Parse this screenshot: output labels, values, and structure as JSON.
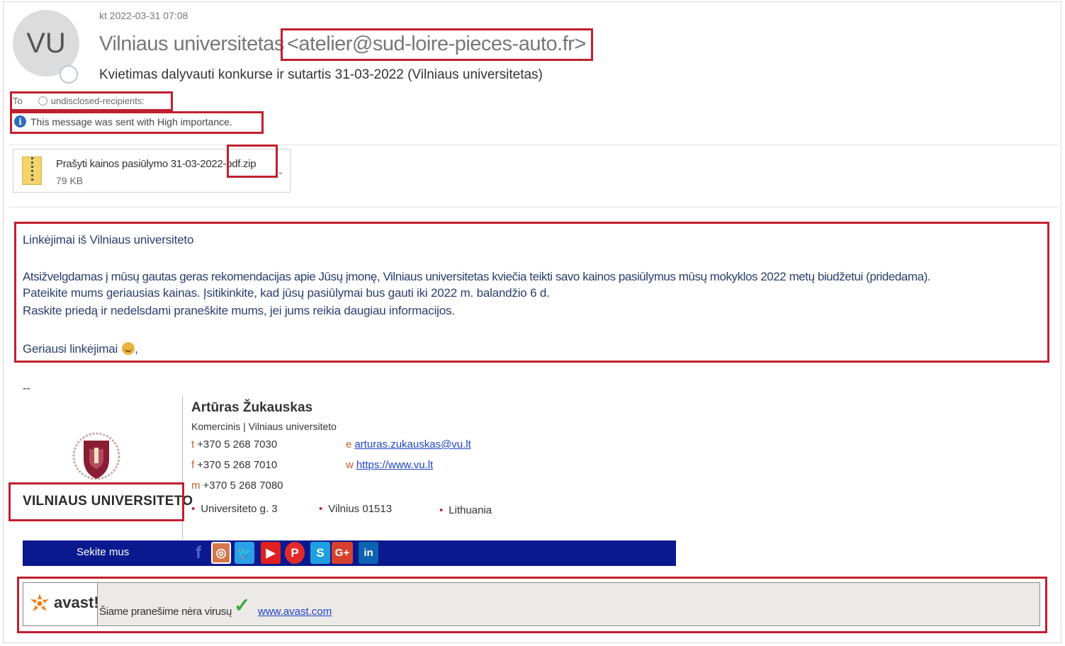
{
  "header": {
    "avatar_initials": "VU",
    "date": "kt 2022-03-31 07:08",
    "sender_name": "Vilniaus universitetas",
    "sender_email": "<atelier@sud-loire-pieces-auto.fr>",
    "subject": "Kvietimas dalyvauti konkurse ir sutartis 31-03-2022 (Vilniaus universitetas)",
    "to_label": "To",
    "to_value": "undisclosed-recipients:",
    "importance_notice": "This message was sent with High importance."
  },
  "attachment": {
    "name": "Prašyti kainos pasiūlymo 31-03-2022-pdf.zip",
    "size": "79 KB",
    "icon": "zip-file-icon"
  },
  "body": {
    "greeting": "Linkėjimai iš Vilniaus universiteto",
    "line1": "Atsižvelgdamas į mūsų gautas geras rekomendacijas apie Jūsų įmonę, Vilniaus universitetas kviečia teikti savo kainos pasiūlymus mūsų mokyklos 2022 metų biudžetui (pridedama).",
    "line2": "Pateikite mums geriausias kainas. Įsitikinkite, kad jūsų pasiūlymai bus gauti iki 2022 m. balandžio 6 d.",
    "line3": "Raskite priedą ir nedelsdami praneškite mums, jei jums reikia daugiau informacijos.",
    "closing": "Geriausi linkėjimai",
    "closing_suffix": ","
  },
  "signature": {
    "dashes": "--",
    "org_name": "VILNIAUS UNIVERSITETO",
    "person_name": "Artūras Žukauskas",
    "role": "Komercinis | Vilniaus universiteto",
    "phone_t_key": "t",
    "phone_t": "+370 5 268 7030",
    "phone_f_key": "f",
    "phone_f": "+370 5 268 7010",
    "phone_m_key": "m",
    "phone_m": "+370 5 268 7080",
    "email_key": "e",
    "email": "arturas.zukauskas@vu.lt",
    "web_key": "w",
    "web": "https://www.vu.lt",
    "address_street": "Universiteto g. 3",
    "address_city": "Vilnius 01513",
    "address_country": "Lithuania",
    "follow_label": "Sekite mus",
    "social": [
      "facebook-icon",
      "instagram-icon",
      "twitter-icon",
      "youtube-icon",
      "pinterest-icon",
      "skype-icon",
      "google-plus-icon",
      "linkedin-icon"
    ]
  },
  "avast": {
    "brand": "avast!",
    "message": "Šiame pranešime nėra virusų",
    "link": "www.avast.com"
  },
  "colors": {
    "highlight_box": "#c0202e",
    "body_text": "#2a3e6e",
    "follow_bar": "#0a1a8e",
    "link": "#1f44c8"
  }
}
